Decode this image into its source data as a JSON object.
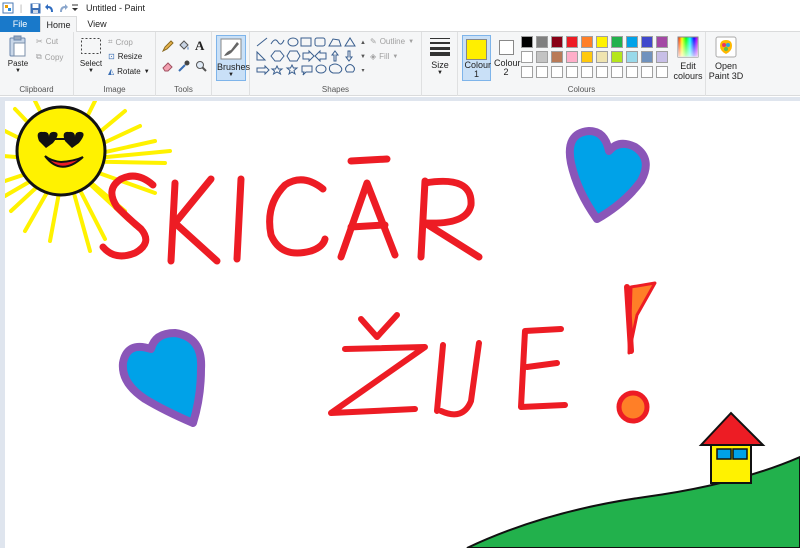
{
  "window": {
    "title": "Untitled - Paint"
  },
  "tabs": [
    {
      "label": "File"
    },
    {
      "label": "Home"
    },
    {
      "label": "View"
    }
  ],
  "clipboard": {
    "group": "Clipboard",
    "paste": "Paste",
    "cut": "Cut",
    "copy": "Copy"
  },
  "image": {
    "group": "Image",
    "select": "Select",
    "crop": "Crop",
    "resize": "Resize",
    "rotate": "Rotate"
  },
  "tools": {
    "group": "Tools",
    "text_tool": "A"
  },
  "brushes": {
    "label": "Brushes"
  },
  "shapes": {
    "group": "Shapes",
    "outline": "Outline",
    "fill": "Fill"
  },
  "size": {
    "label": "Size"
  },
  "colours": {
    "group": "Colours",
    "colour1": "Colour 1",
    "colour2": "Colour 2",
    "colour1_value": "#ffef00",
    "colour2_value": "#ffffff",
    "edit": "Edit colours",
    "palette_row1": [
      "#000000",
      "#7f7f7f",
      "#880015",
      "#ed1c24",
      "#ff7f27",
      "#fff200",
      "#22b14c",
      "#00a2e8",
      "#3f48cc",
      "#a349a4"
    ],
    "palette_row2": [
      "#ffffff",
      "#c3c3c3",
      "#b97a57",
      "#ffaec9",
      "#ffc90e",
      "#efe4b0",
      "#b5e61d",
      "#99d9ea",
      "#7092be",
      "#c8bfe7"
    ]
  },
  "paint3d": {
    "label": "Open Paint 3D"
  },
  "drawing": {
    "word1": "SKICĀR",
    "word2": "ŽIJE",
    "word3": "!"
  }
}
